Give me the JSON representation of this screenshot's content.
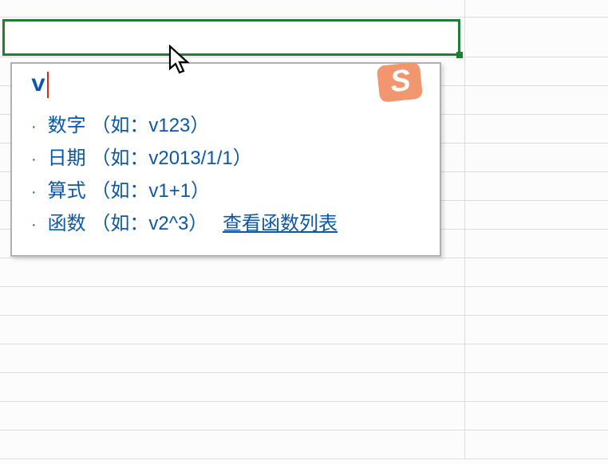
{
  "cell": {
    "typed_value": "v"
  },
  "tooltip": {
    "hints": [
      {
        "label": "数字",
        "example": "（如：v123）"
      },
      {
        "label": "日期",
        "example": "（如：v2013/1/1）"
      },
      {
        "label": "算式",
        "example": "（如：v1+1）"
      },
      {
        "label": "函数",
        "example": "（如：v2^3）"
      }
    ],
    "link_label": "查看函数列表"
  },
  "ime": {
    "logo_letter": "S",
    "logo_color": "#f2966f"
  }
}
